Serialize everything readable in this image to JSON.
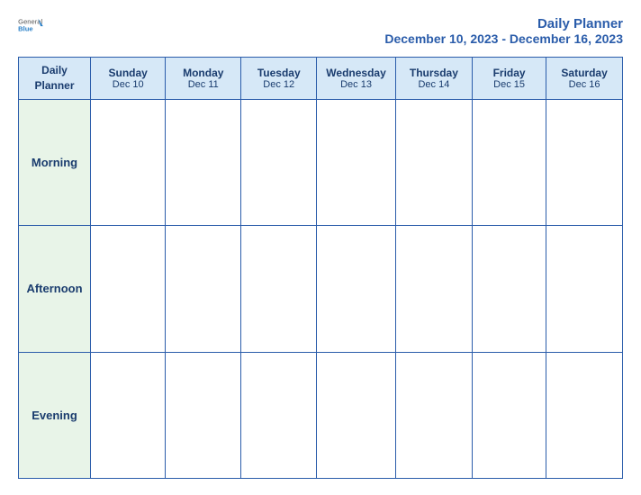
{
  "header": {
    "logo": {
      "general": "General",
      "blue": "Blue",
      "triangle_color": "#2a80c8"
    },
    "title": "Daily Planner",
    "date_range": "December 10, 2023 - December 16, 2023"
  },
  "table": {
    "first_header": {
      "line1": "Daily",
      "line2": "Planner"
    },
    "days": [
      {
        "name": "Sunday",
        "date": "Dec 10"
      },
      {
        "name": "Monday",
        "date": "Dec 11"
      },
      {
        "name": "Tuesday",
        "date": "Dec 12"
      },
      {
        "name": "Wednesday",
        "date": "Dec 13"
      },
      {
        "name": "Thursday",
        "date": "Dec 14"
      },
      {
        "name": "Friday",
        "date": "Dec 15"
      },
      {
        "name": "Saturday",
        "date": "Dec 16"
      }
    ],
    "rows": [
      {
        "label": "Morning"
      },
      {
        "label": "Afternoon"
      },
      {
        "label": "Evening"
      }
    ]
  }
}
